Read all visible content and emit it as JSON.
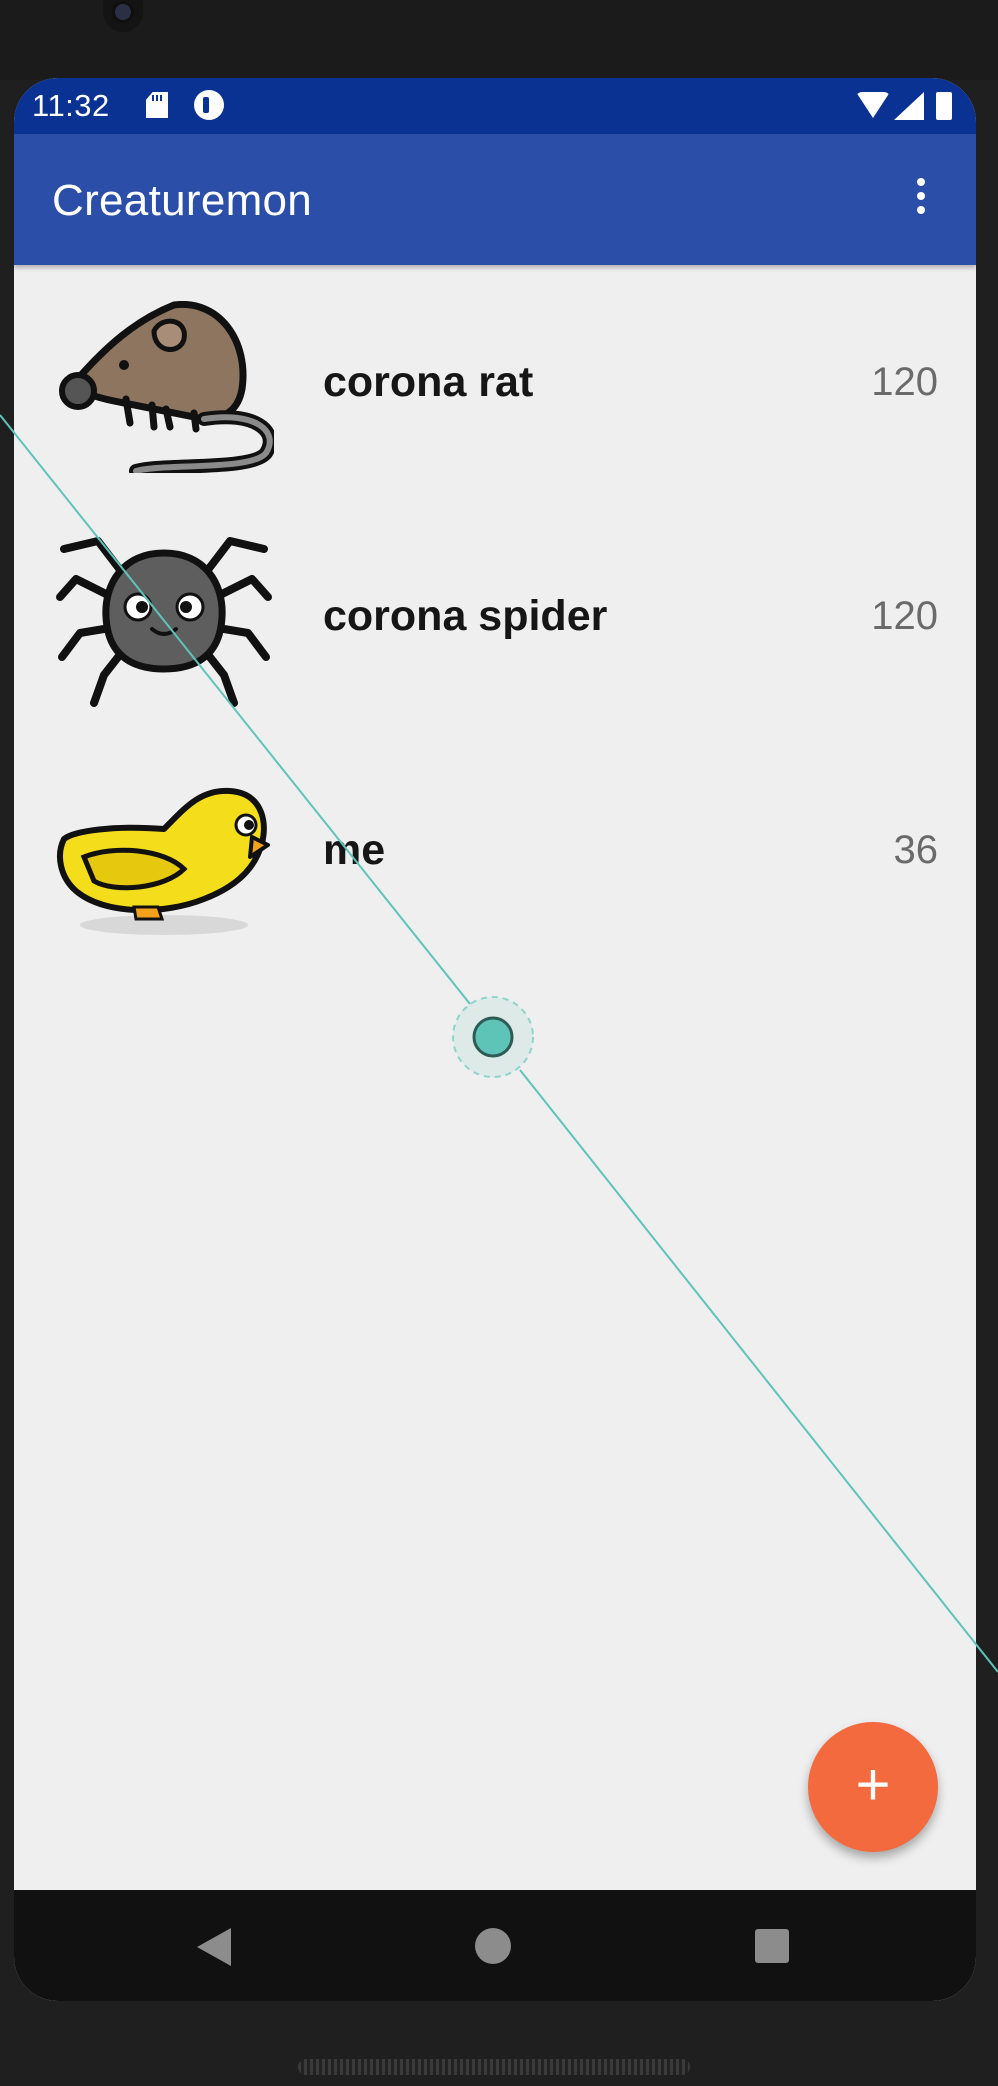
{
  "status_bar": {
    "time": "11:32",
    "icons": [
      "sd-card-icon",
      "app-notification-icon",
      "wifi-icon",
      "cell-signal-icon",
      "battery-icon"
    ]
  },
  "toolbar": {
    "title": "Creaturemon",
    "menu_icon": "overflow-menu-icon"
  },
  "creatures": [
    {
      "name": "corona rat",
      "value": "120",
      "image": "rat"
    },
    {
      "name": "corona spider",
      "value": "120",
      "image": "spider"
    },
    {
      "name": "me",
      "value": "36",
      "image": "duck"
    }
  ],
  "fab": {
    "label": "+",
    "icon": "add-icon",
    "color": "#f26a3e"
  },
  "nav_bar": {
    "icons": [
      "back-icon",
      "home-icon",
      "recents-icon"
    ]
  },
  "colors": {
    "status_bar": "#0a3293",
    "app_bar": "#2b4ea8",
    "background": "#efefef",
    "touch_indicator": "#5fc4b8"
  }
}
